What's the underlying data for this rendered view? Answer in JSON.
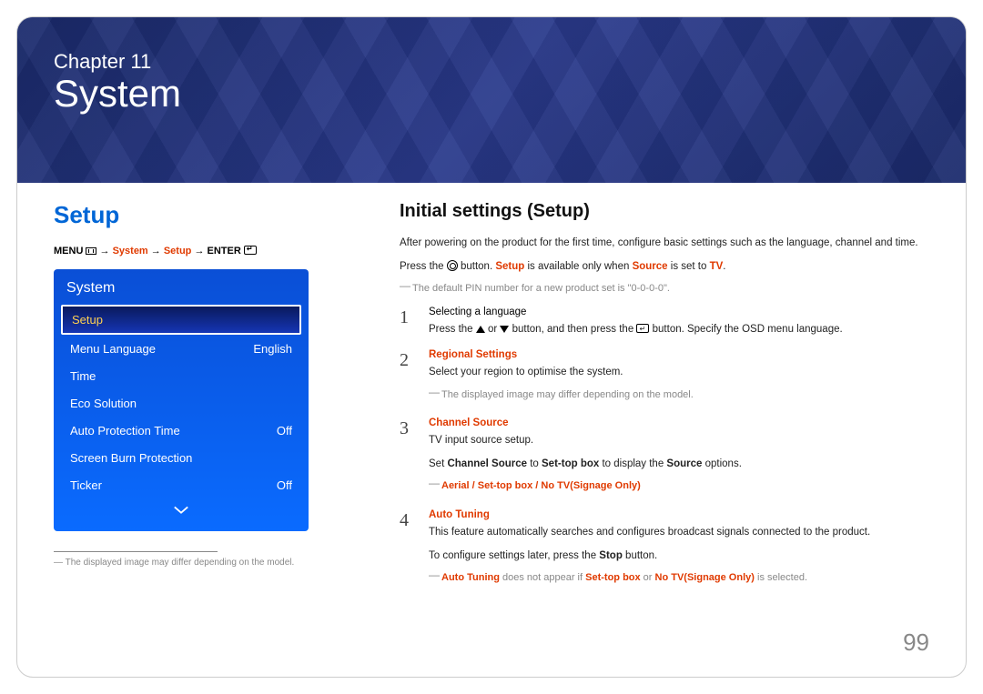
{
  "header": {
    "chapter_label": "Chapter 11",
    "chapter_title": "System"
  },
  "left": {
    "section_heading": "Setup",
    "menu_path": {
      "menu": "MENU",
      "arrow": "→",
      "seg1": "System",
      "seg2": "Setup",
      "enter": "ENTER"
    },
    "osd": {
      "title": "System",
      "items": [
        {
          "label": "Setup",
          "value": "",
          "selected": true
        },
        {
          "label": "Menu Language",
          "value": "English",
          "selected": false
        },
        {
          "label": "Time",
          "value": "",
          "selected": false
        },
        {
          "label": "Eco Solution",
          "value": "",
          "selected": false
        },
        {
          "label": "Auto Protection Time",
          "value": "Off",
          "selected": false
        },
        {
          "label": "Screen Burn Protection",
          "value": "",
          "selected": false
        },
        {
          "label": "Ticker",
          "value": "Off",
          "selected": false
        }
      ]
    },
    "footnote": "The displayed image may differ depending on the model."
  },
  "right": {
    "heading": "Initial settings (Setup)",
    "intro1": "After powering on the product for the first time, configure basic settings such as the language, channel and time.",
    "intro2_pre": "Press the ",
    "intro2_mid1": " button. ",
    "intro2_setup": "Setup",
    "intro2_mid2": " is available only when ",
    "intro2_source": "Source",
    "intro2_mid3": " is set to ",
    "intro2_tv": "TV",
    "intro2_end": ".",
    "note1": "The default PIN number for a new product set is \"0-0-0-0\".",
    "steps": [
      {
        "num": "1",
        "title": "Selecting a language",
        "title_hl": false,
        "body_pre": "Press the ",
        "body_mid": " or ",
        "body_post": " button, and then press the ",
        "body_end": " button. Specify the OSD menu language."
      },
      {
        "num": "2",
        "title": "Regional Settings",
        "title_hl": true,
        "body": "Select your region to optimise the system.",
        "note": "The displayed image may differ depending on the model."
      },
      {
        "num": "3",
        "title": "Channel Source",
        "title_hl": true,
        "body": "TV input source setup.",
        "line2_pre": "Set ",
        "line2_a": "Channel Source",
        "line2_mid": " to ",
        "line2_b": "Set-top box",
        "line2_mid2": " to display the ",
        "line2_c": "Source",
        "line2_end": " options.",
        "note_options": "Aerial / Set-top box / No TV(Signage Only)"
      },
      {
        "num": "4",
        "title": "Auto Tuning",
        "title_hl": true,
        "body": "This feature automatically searches and configures broadcast signals connected to the product.",
        "line2_pre": "To configure settings later, press the ",
        "line2_stop": "Stop",
        "line2_end": " button.",
        "note_pre": "Auto Tuning",
        "note_mid1": " does not appear if ",
        "note_a": "Set-top box",
        "note_mid2": " or ",
        "note_b": "No TV(Signage Only)",
        "note_end": " is selected."
      }
    ]
  },
  "page_number": "99"
}
